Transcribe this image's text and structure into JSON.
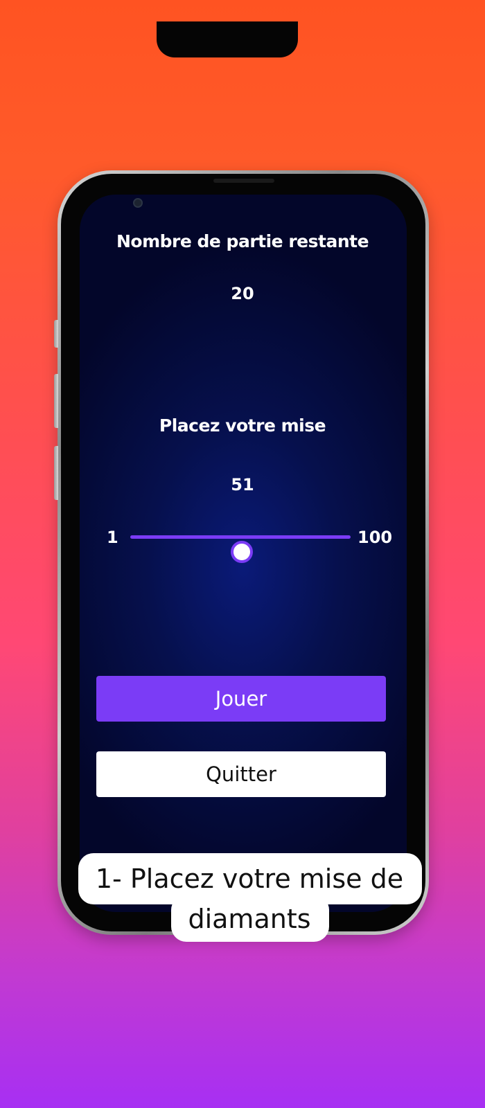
{
  "game": {
    "remaining_title": "Nombre de partie restante",
    "remaining_count": "20",
    "bet_title": "Placez votre mise",
    "bet_value": "51",
    "slider": {
      "min_label": "1",
      "max_label": "100",
      "min": 1,
      "max": 100,
      "value": 51
    },
    "play_label": "Jouer",
    "quit_label": "Quitter"
  },
  "caption": "1- Placez votre mise de diamants",
  "colors": {
    "accent": "#7b3cf6",
    "screen_bg": "#06104d",
    "bg_top": "#ff5322",
    "bg_bottom": "#a72ff3"
  },
  "icons": [
    "front-camera-icon"
  ]
}
